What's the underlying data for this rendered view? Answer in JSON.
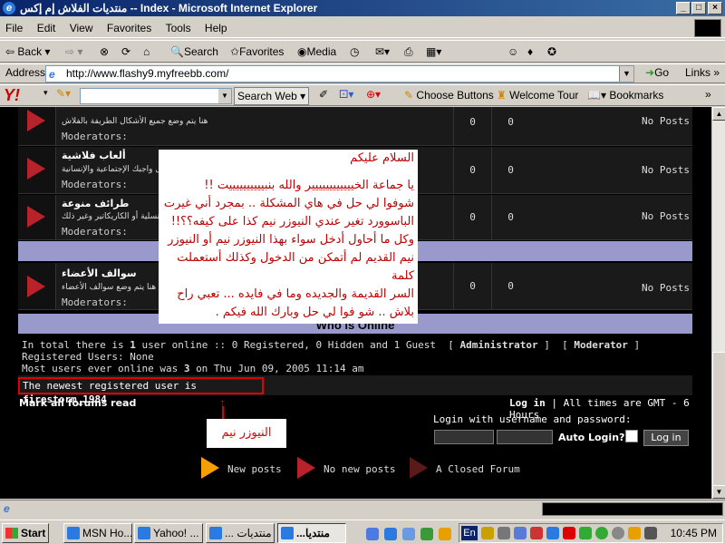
{
  "window": {
    "title": "منتديات الفلاش إم إكس -- Index - Microsoft Internet Explorer"
  },
  "menu": [
    "File",
    "Edit",
    "View",
    "Favorites",
    "Tools",
    "Help"
  ],
  "toolbar": {
    "back": "Back",
    "search": "Search",
    "favorites": "Favorites",
    "media": "Media"
  },
  "address": {
    "label": "Address",
    "url": "http://www.flashy9.myfreebb.com/",
    "go": "Go",
    "links": "Links"
  },
  "yahoo": {
    "logo": "Y!",
    "search_web": "Search Web",
    "choose_buttons": "Choose Buttons",
    "welcome_tour": "Welcome Tour",
    "bookmarks": "Bookmarks"
  },
  "forums": [
    {
      "title": "",
      "desc": "هنا يتم وضع جميع الأشكال الطريفة بالفلاش",
      "mods": "Moderators:",
      "topics": "0",
      "posts": "0",
      "last": "No Posts"
    },
    {
      "title": "ألعاب فلاشية",
      "desc": "أن تهمل واجبك الإجتماعية والإنسانية",
      "mods": "Moderators:",
      "topics": "0",
      "posts": "0",
      "last": "No Posts"
    },
    {
      "title": "طرائف منوعة",
      "desc": "فى التسلية أو الكاريكاتير وغير ذلك",
      "mods": "Moderators:",
      "topics": "0",
      "posts": "0",
      "last": "No Posts"
    },
    {
      "title": "سوالف الأعضاء",
      "desc": "هنا يتم وضع سوالف الأعضاء",
      "mods": "Moderators:",
      "topics": "0",
      "posts": "0",
      "last": "No Posts"
    }
  ],
  "popup": {
    "lines": [
      "السلام عليكم",
      "يا جماعة الخيييييييييييير  والله بنبييييييييييت !!",
      "شوفوا لي حل في هاي المشكلة .. بمجرد أني غيرت",
      "الباسوورد تغير عندي النيوزر نيم كذا على كيفه؟؟!!",
      "وكل ما أحاول أدخل سواء بهذا النيوزر نيم أو النيوزر",
      "نيم القديم لم أتمكن من الدخول وكذلك أستعملت كلمة",
      "السر القديمة والجديده وما في فايده ... تعبي راح",
      "بلاش .. شو فوا لي حل وبارك الله فيكم ."
    ]
  },
  "who_is_online": {
    "heading": "Who is Online",
    "line1_a": "In total there is",
    "line1_count": "1",
    "line1_b": "user online :: 0 Registered, 0 Hidden and 1 Guest",
    "admin": "Administrator",
    "moderator": "Moderator",
    "line2": "Registered Users: None",
    "line3_a": "Most users ever online was",
    "line3_count": "3",
    "line3_b": "on Thu Jun 09, 2005 11:14 am",
    "newest_prefix": "The newest registered user is",
    "newest_user": "firestorm_1984"
  },
  "footer": {
    "mark_read": "Mark all forums read",
    "login_link": "Log in",
    "timezone": "All times are GMT - 6 Hours",
    "login_prompt": "Login with username and password:",
    "auto_login": "Auto Login?",
    "login_button": "Log in",
    "annotation": "النيوزر نيم"
  },
  "legend": {
    "new_posts": "New posts",
    "no_new_posts": "No new posts",
    "closed": "A Closed Forum"
  },
  "taskbar": {
    "start": "Start",
    "tasks": [
      "MSN Ho...",
      "Yahoo! ...",
      "منتديات ...",
      "منتديا..."
    ],
    "lang": "En",
    "clock": "10:45 PM"
  },
  "colors": {
    "icon_new": "#f5a000",
    "icon_none": "#b8222a",
    "icon_closed": "#5a1a1a",
    "popup_text": "#c00000",
    "highlight_box": "#e00000",
    "category_bar": "#9999cc"
  }
}
